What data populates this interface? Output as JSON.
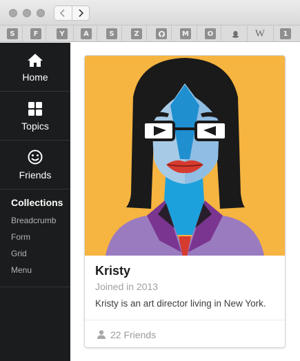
{
  "browser": {
    "back_icon": "chevron-left-icon",
    "forward_icon": "chevron-right-icon",
    "bookmarks": [
      {
        "label": "S"
      },
      {
        "label": "F"
      },
      {
        "label": "Y"
      },
      {
        "label": "A"
      },
      {
        "label": "S"
      },
      {
        "label": "Z"
      },
      {
        "icon": "github-icon"
      },
      {
        "label": "M"
      },
      {
        "label": "O"
      },
      {
        "icon": "qq-penguin-icon"
      },
      {
        "label": "W"
      },
      {
        "label": "1"
      }
    ]
  },
  "sidebar": {
    "items": [
      {
        "label": "Home",
        "icon": "home-icon"
      },
      {
        "label": "Topics",
        "icon": "grid-icon"
      },
      {
        "label": "Friends",
        "icon": "smile-icon"
      }
    ],
    "collections_header": "Collections",
    "collections": [
      "Breadcrumb",
      "Form",
      "Grid",
      "Menu"
    ]
  },
  "card": {
    "name": "Kristy",
    "meta": "Joined in 2013",
    "description": "Kristy is an art director living in New York.",
    "friends": "22 Friends",
    "friends_icon": "user-icon",
    "avatar_bg": "#f6b440"
  }
}
